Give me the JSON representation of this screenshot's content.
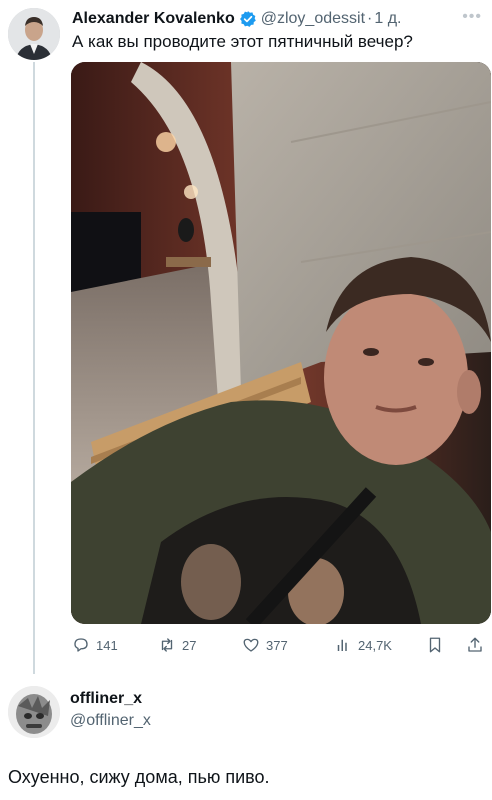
{
  "tweet": {
    "author_name": "Alexander Kovalenko",
    "handle": "@zloy_odessit",
    "separator": "·",
    "time": "1 д.",
    "text": "А как вы проводите этот пятничный вечер?",
    "more_icon": "more-horizontal-icon",
    "verified_color": "#1d9bf0",
    "photo_description_icon": "photo"
  },
  "actions": {
    "replies": "141",
    "retweets": "27",
    "likes": "377",
    "views": "24,7K"
  },
  "reply": {
    "author_name": "offliner_x",
    "handle": "@offliner_x",
    "text": "Охуенно, сижу дома, пью пиво."
  },
  "colors": {
    "text": "#0f1419",
    "secondary": "#536471",
    "thread_line": "#cfd9de"
  }
}
